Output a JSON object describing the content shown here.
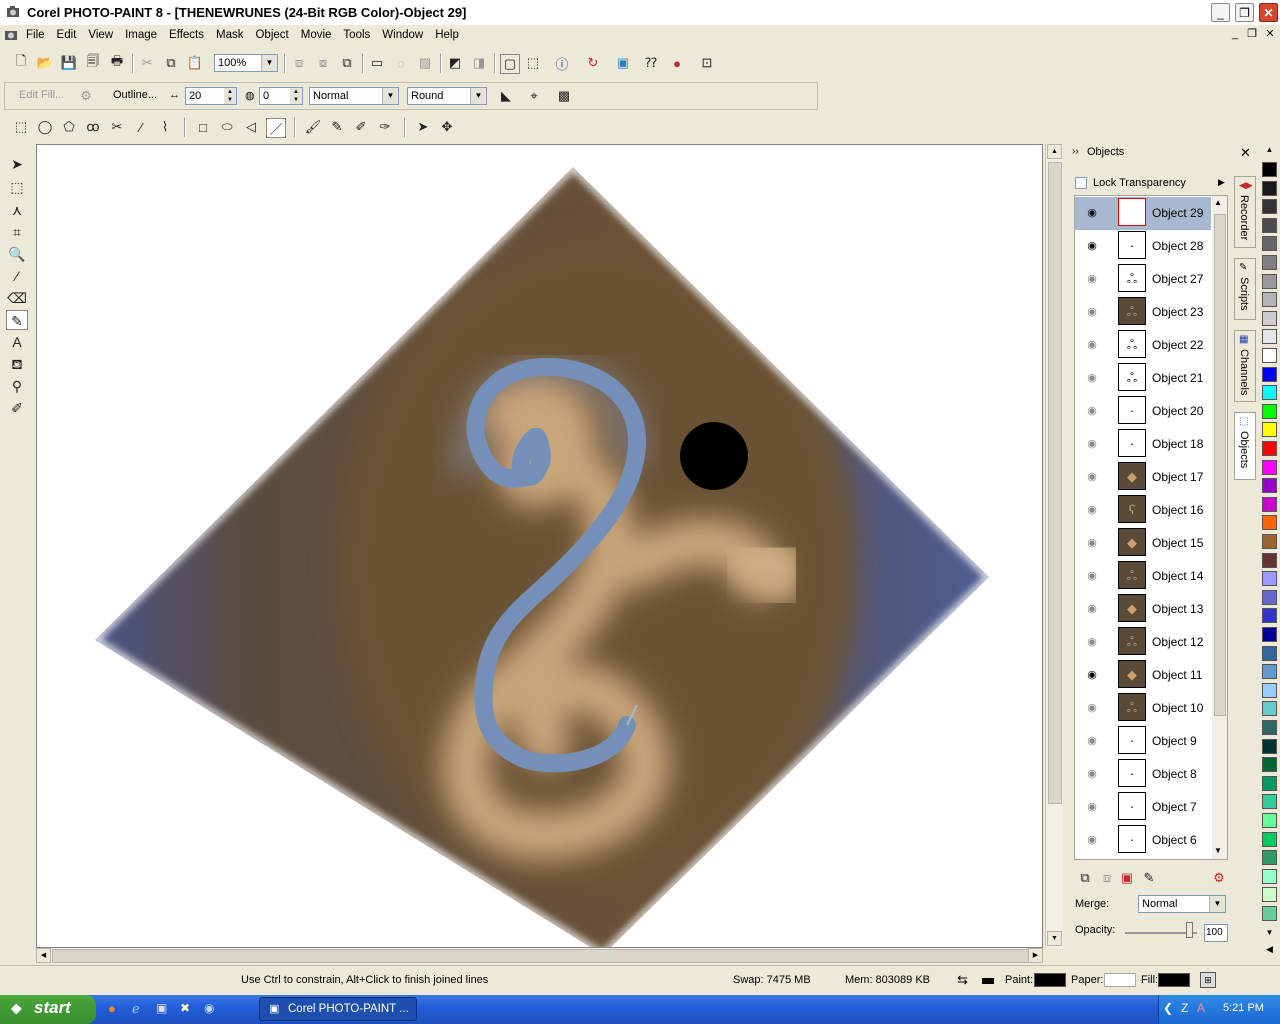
{
  "window": {
    "title": "Corel PHOTO-PAINT 8 - [THENEWRUNES  (24-Bit RGB Color)-Object 29]",
    "minimize": "_",
    "restore": "❐",
    "close": "✕"
  },
  "menu": [
    "File",
    "Edit",
    "View",
    "Image",
    "Effects",
    "Mask",
    "Object",
    "Movie",
    "Tools",
    "Window",
    "Help"
  ],
  "mdi_controls": {
    "minimize": "_",
    "restore": "❐",
    "close": "✕"
  },
  "standard_toolbar": {
    "zoom": "100%"
  },
  "property_bar": {
    "edit_fill": "Edit Fill...",
    "outline": "Outline...",
    "width": "20",
    "transparency": "0",
    "merge_mode": "Normal",
    "joint": "Round"
  },
  "objects_panel": {
    "title": "Objects",
    "lock_transparency": "Lock Transparency",
    "objects": [
      {
        "name": "Object 29",
        "eye": true,
        "thumb": "",
        "selected": true,
        "red": true
      },
      {
        "name": "Object 28",
        "eye": true,
        "thumb": "·"
      },
      {
        "name": "Object 27",
        "eye": false,
        "thumb": "ஃ"
      },
      {
        "name": "Object 23",
        "eye": false,
        "thumb": "ஃ",
        "dark": true
      },
      {
        "name": "Object 22",
        "eye": false,
        "thumb": "ஃ"
      },
      {
        "name": "Object 21",
        "eye": false,
        "thumb": "ஃ"
      },
      {
        "name": "Object 20",
        "eye": false,
        "thumb": "·"
      },
      {
        "name": "Object 18",
        "eye": false,
        "thumb": "·"
      },
      {
        "name": "Object 17",
        "eye": false,
        "thumb": "◆",
        "dark": true
      },
      {
        "name": "Object 16",
        "eye": false,
        "thumb": "ʕ",
        "dark": true
      },
      {
        "name": "Object 15",
        "eye": false,
        "thumb": "◆",
        "dark": true
      },
      {
        "name": "Object 14",
        "eye": false,
        "thumb": "ஃ",
        "dark": true
      },
      {
        "name": "Object 13",
        "eye": false,
        "thumb": "◆",
        "dark": true
      },
      {
        "name": "Object 12",
        "eye": false,
        "thumb": "ஃ",
        "dark": true
      },
      {
        "name": "Object 11",
        "eye": true,
        "thumb": "◆",
        "dark": true
      },
      {
        "name": "Object 10",
        "eye": false,
        "thumb": "ஃ",
        "dark": true
      },
      {
        "name": "Object 9",
        "eye": false,
        "thumb": "·"
      },
      {
        "name": "Object 8",
        "eye": false,
        "thumb": "·"
      },
      {
        "name": "Object 7",
        "eye": false,
        "thumb": "·"
      },
      {
        "name": "Object 6",
        "eye": false,
        "thumb": "·"
      }
    ],
    "merge_label": "Merge:",
    "merge_value": "Normal",
    "opacity_label": "Opacity:",
    "opacity_value": "100"
  },
  "side_tabs": [
    "Recorder",
    "Scripts",
    "Channels",
    "Objects"
  ],
  "palette": [
    "#000000",
    "#1a1a1a",
    "#333333",
    "#4d4d4d",
    "#666666",
    "#808080",
    "#999999",
    "#b3b3b3",
    "#cccccc",
    "#e6e6e6",
    "#ffffff",
    "#0000ff",
    "#00ffff",
    "#00ff00",
    "#ffff00",
    "#ff0000",
    "#ff00ff",
    "#9900cc",
    "#cc00cc",
    "#ff6600",
    "#996633",
    "#663333",
    "#9999ff",
    "#6666cc",
    "#3333cc",
    "#000099",
    "#336699",
    "#6699cc",
    "#99ccff",
    "#66cccc",
    "#336666",
    "#003333",
    "#006633",
    "#009966",
    "#33cc99",
    "#66ff99",
    "#00cc66",
    "#339966",
    "#99ffcc",
    "#ccffcc",
    "#66cc99"
  ],
  "status": {
    "hint": "Use Ctrl to constrain, Alt+Click to finish joined lines",
    "swap": "Swap: 7475 MB",
    "mem": "Mem: 803089 KB",
    "paint_label": "Paint:",
    "paper_label": "Paper:",
    "fill_label": "Fill:",
    "paint_color": "#000000",
    "paper_color": "#ffffff",
    "fill_color": "#000000"
  },
  "taskbar": {
    "start": "start",
    "task": "Corel PHOTO-PAINT ...",
    "clock": "5:21 PM"
  }
}
